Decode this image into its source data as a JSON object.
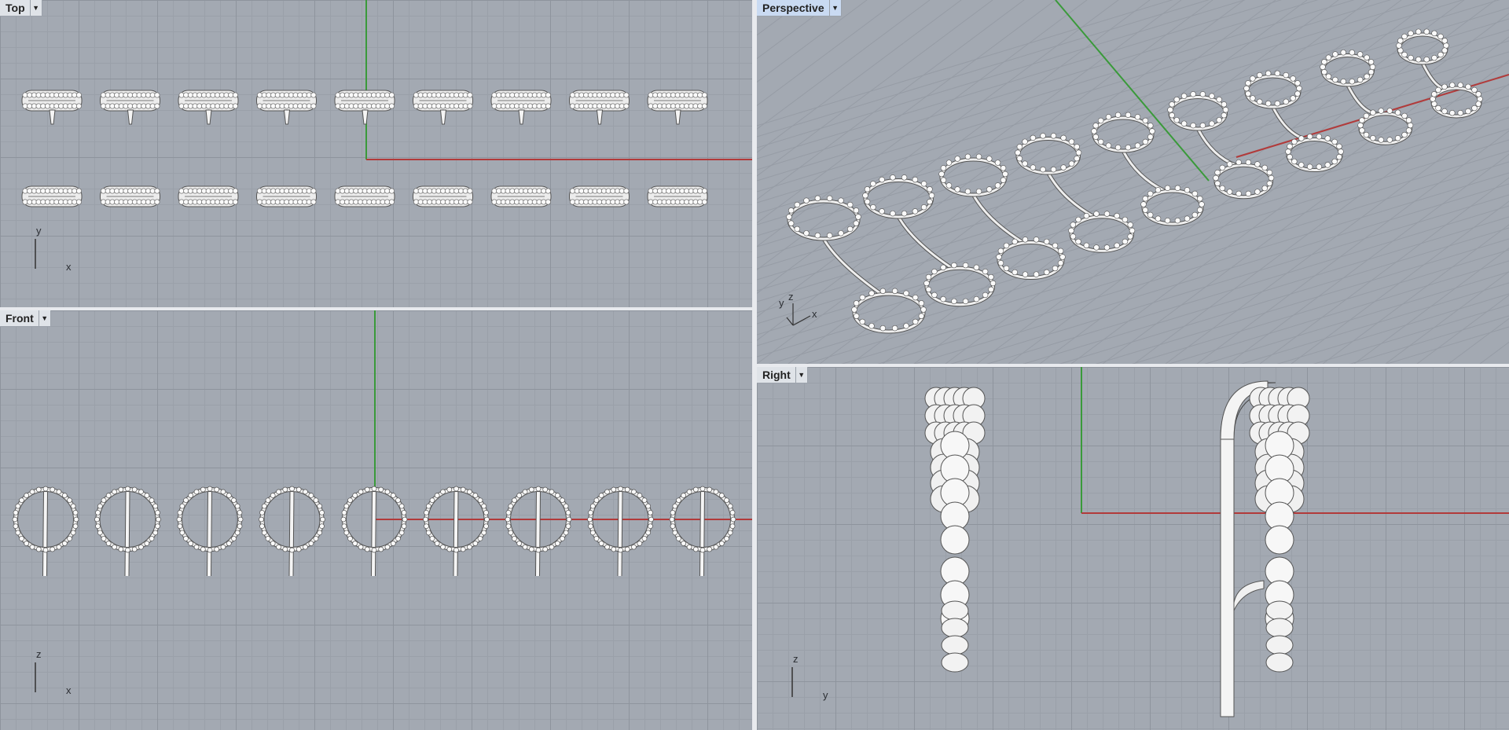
{
  "viewports": {
    "top": {
      "title": "Top",
      "axis_a": "y",
      "axis_b": "x"
    },
    "perspective": {
      "title": "Perspective",
      "axis_a": "z",
      "axis_b": "x",
      "axis_c": "y"
    },
    "front": {
      "title": "Front",
      "axis_a": "z",
      "axis_b": "x"
    },
    "right": {
      "title": "Right",
      "axis_a": "z",
      "axis_b": "y"
    }
  },
  "dropdown_icon": "triangle-down-icon",
  "colors": {
    "viewport_bg": "#a3a9b2",
    "x_axis": "#b23a3a",
    "y_axis": "#3a9a3a",
    "active_tab": "#c9daf2"
  },
  "model": {
    "ring_count_per_row": 9,
    "rows": 2
  }
}
